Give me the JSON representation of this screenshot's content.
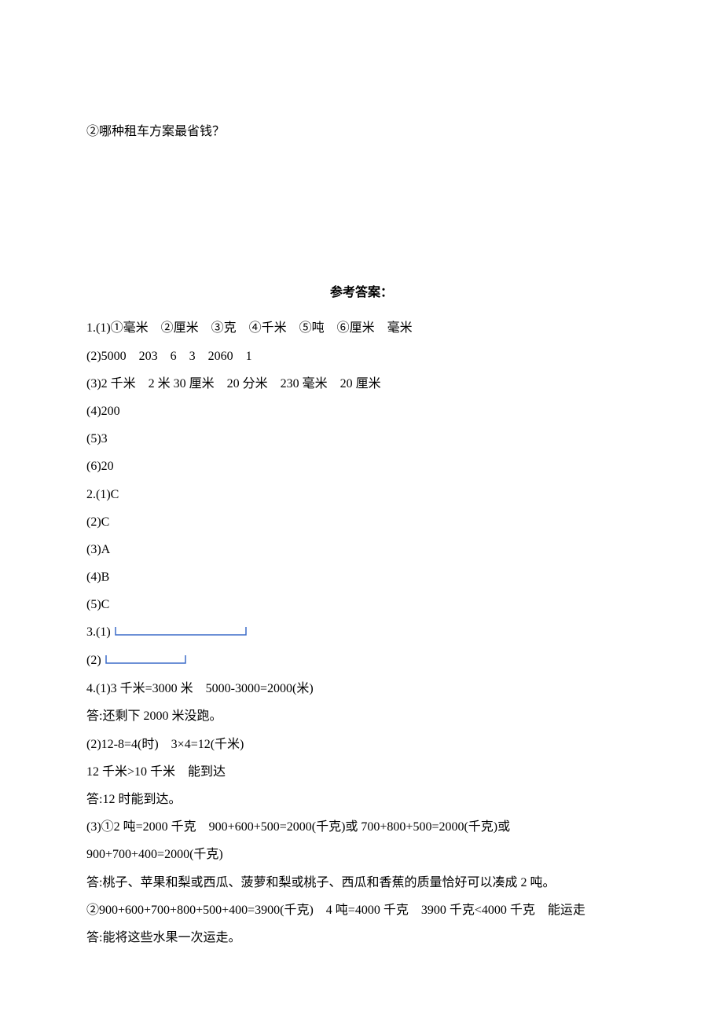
{
  "question": "②哪种租车方案最省钱？",
  "answerTitle": "参考答案：",
  "lines": {
    "l1": "1.(1)①毫米　②厘米　③克　④千米　⑤吨　⑥厘米　毫米",
    "l2": "(2)5000　203　6　3　2060　1",
    "l3": "(3)2 千米　2 米 30 厘米　20 分米　230 毫米　20 厘米",
    "l4": "(4)200",
    "l5": "(5)3",
    "l6": "(6)20",
    "l7": "2.(1)C",
    "l8": "(2)C",
    "l9": "(3)A",
    "l10": "(4)B",
    "l11": "(5)C",
    "l12": "3.(1)",
    "l13": "(2)",
    "l14": "4.(1)3 千米=3000 米　5000-3000=2000(米)",
    "l15": "答:还剩下 2000 米没跑。",
    "l16": "(2)12-8=4(时)　3×4=12(千米)",
    "l17": "12 千米>10 千米　能到达",
    "l18": "答:12 时能到达。",
    "l19": "(3)①2 吨=2000 千克　900+600+500=2000(千克)或 700+800+500=2000(千克)或",
    "l20": "900+700+400=2000(千克)",
    "l21": "答:桃子、苹果和梨或西瓜、菠萝和梨或桃子、西瓜和香蕉的质量恰好可以凑成 2 吨。",
    "l22": "②900+600+700+800+500+400=3900(千克)　4 吨=4000 千克　3900 千克<4000 千克　能运走",
    "l23": "答:能将这些水果一次运走。"
  }
}
